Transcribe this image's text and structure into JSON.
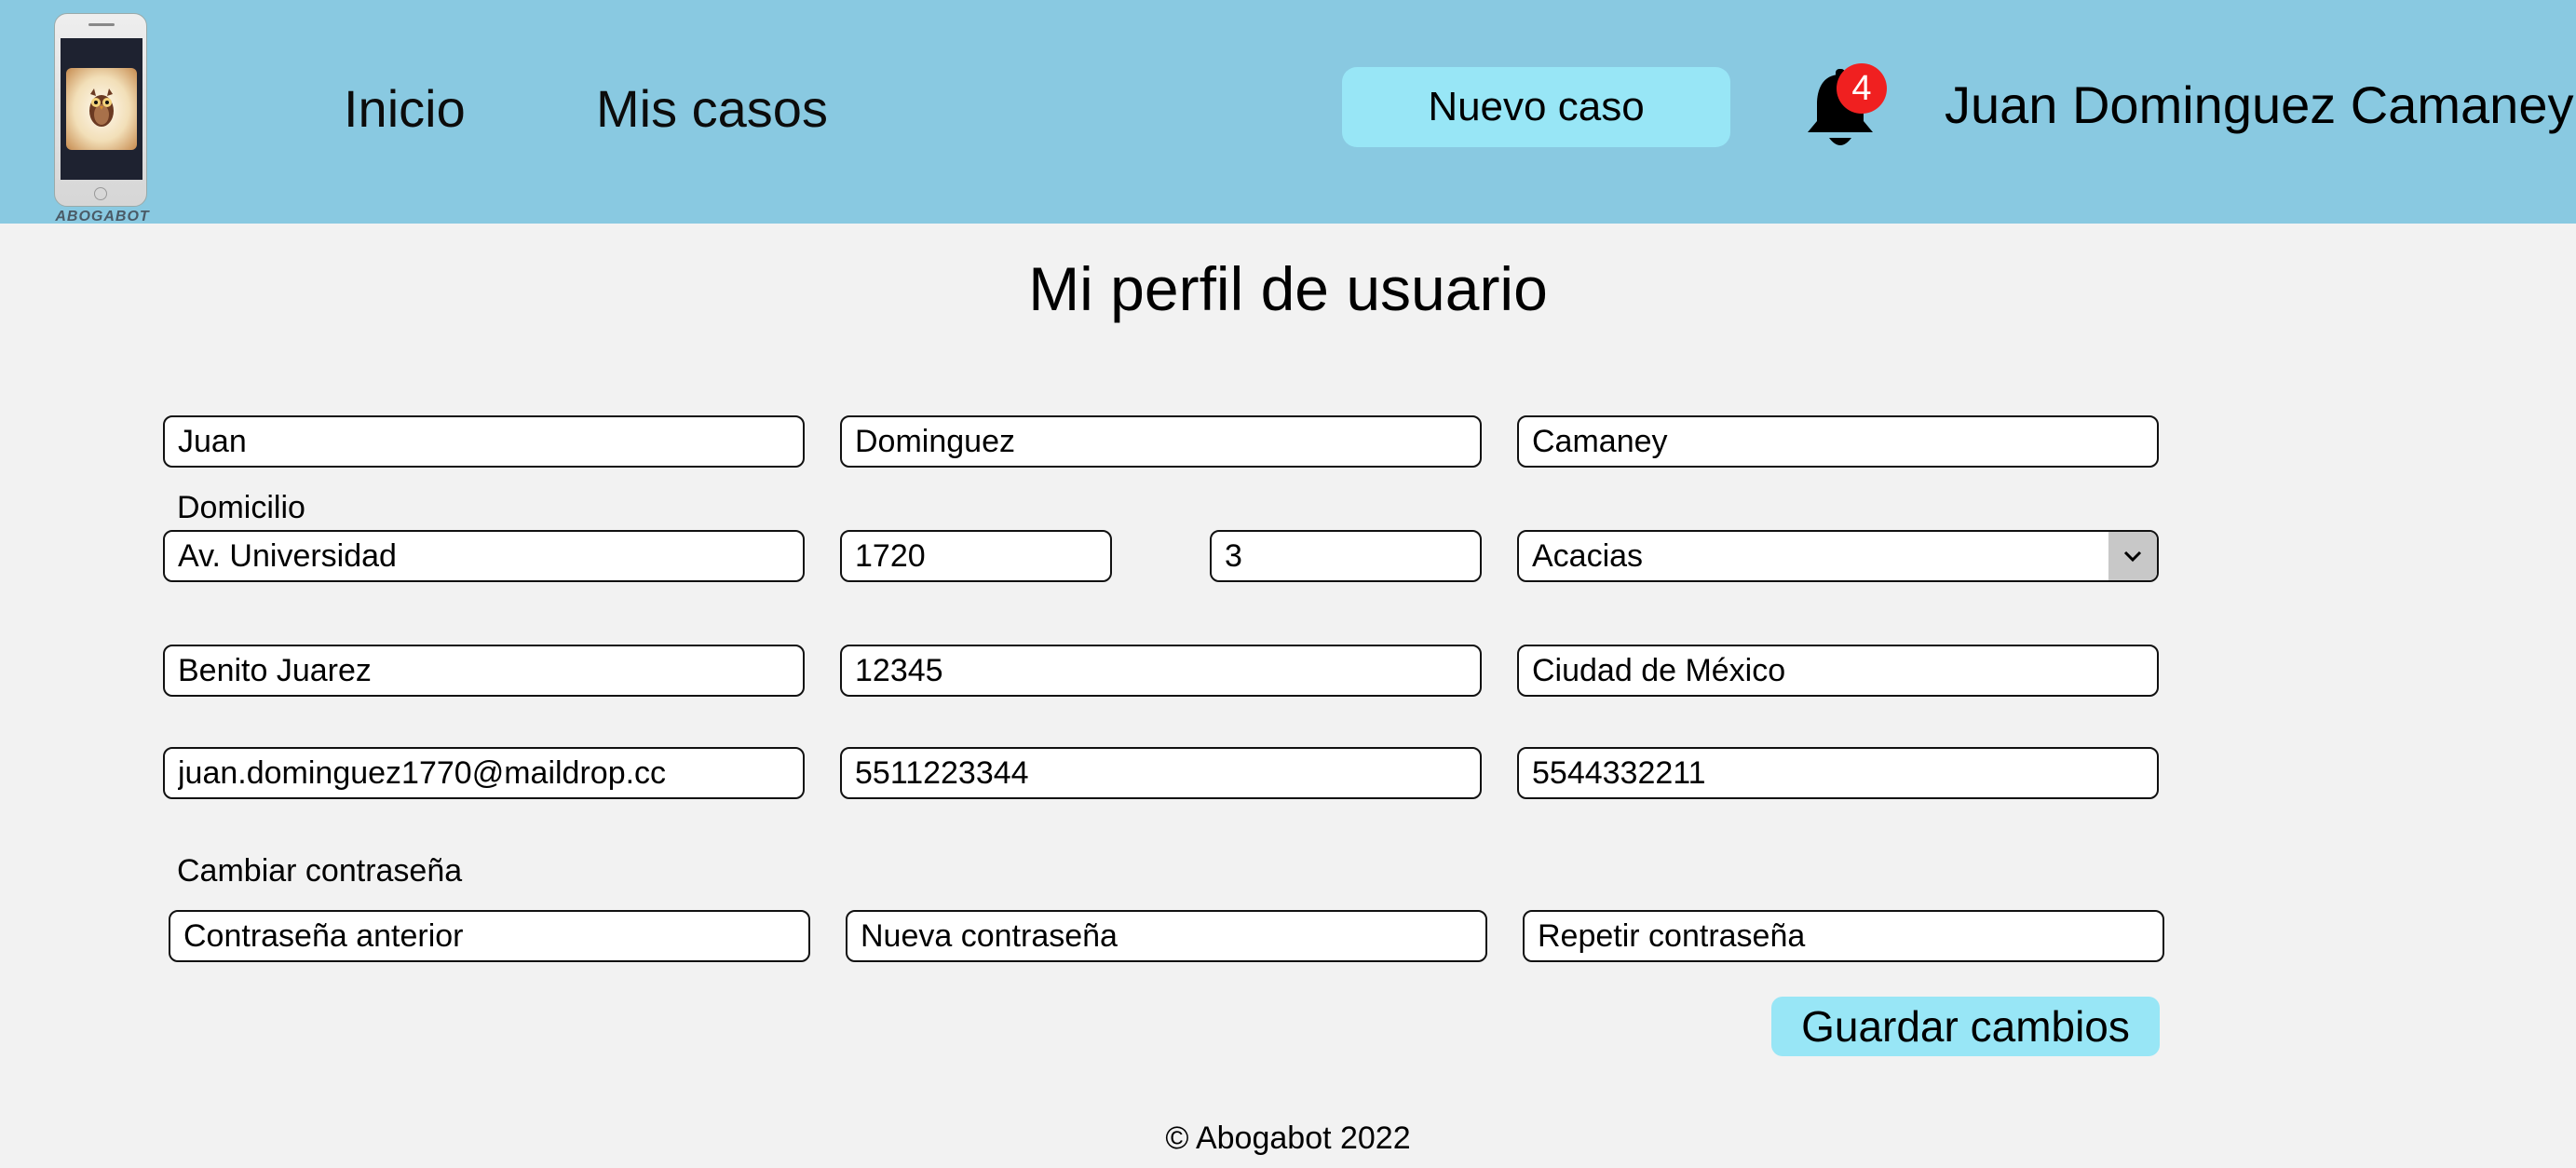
{
  "header": {
    "logo_text": "ABOGABOT",
    "nav": [
      {
        "label": "Inicio"
      },
      {
        "label": "Mis casos"
      }
    ],
    "new_case_label": "Nuevo caso",
    "notification_count": "4",
    "user_name": "Juan Dominguez Camaney"
  },
  "page_title": "Mi perfil de usuario",
  "form": {
    "first_name": "Juan",
    "last_name_1": "Dominguez",
    "last_name_2": "Camaney",
    "address_label": "Domicilio",
    "street": "Av. Universidad",
    "ext_number": "1720",
    "int_number": "3",
    "neighborhood": "Acacias",
    "municipality": "Benito Juarez",
    "postal_code": "12345",
    "city": "Ciudad de México",
    "email": "juan.dominguez1770@maildrop.cc",
    "phone_1": "5511223344",
    "phone_2": "5544332211",
    "password_label": "Cambiar contraseña",
    "old_password_placeholder": "Contraseña anterior",
    "new_password_placeholder": "Nueva contraseña",
    "repeat_password_placeholder": "Repetir contraseña",
    "save_label": "Guardar cambios"
  },
  "footer": {
    "text": "© Abogabot 2022"
  },
  "colors": {
    "header_bg": "#89c9e1",
    "button_bg": "#98e6f6",
    "badge_bg": "#f02020",
    "page_bg": "#f2f2f2"
  },
  "icons": {
    "bell": "bell-icon",
    "dropdown": "chevron-down-icon",
    "logo": "owl-phone-logo"
  }
}
